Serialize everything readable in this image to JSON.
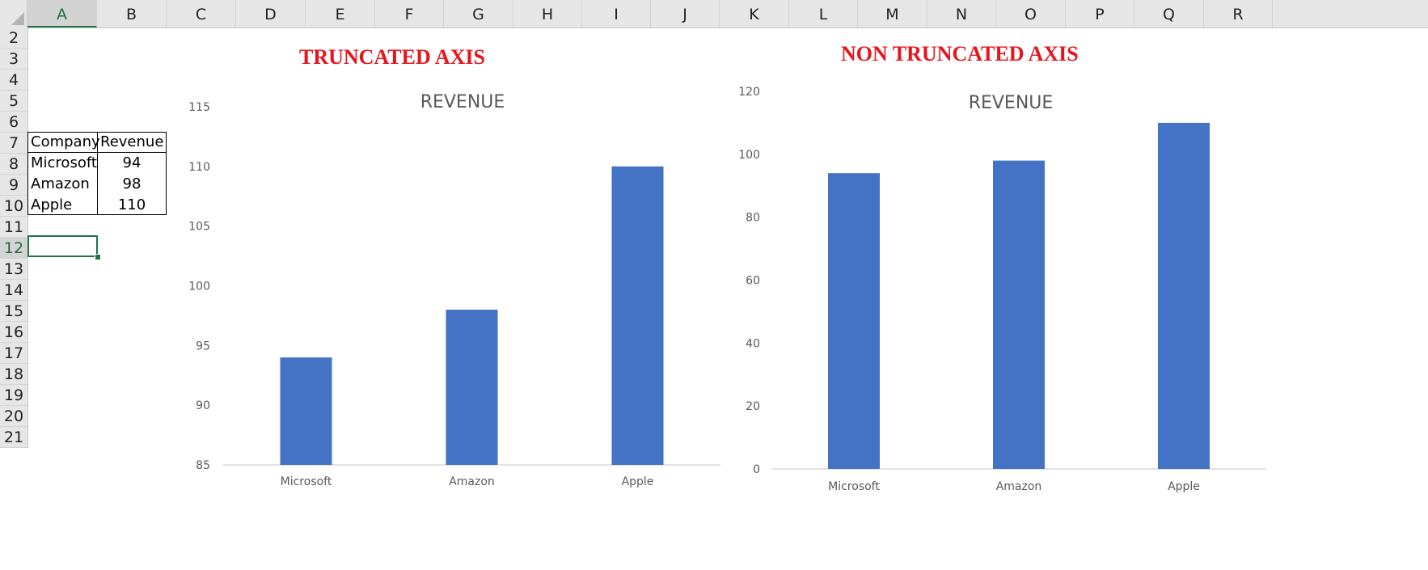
{
  "spreadsheet": {
    "columns": [
      "A",
      "B",
      "C",
      "D",
      "E",
      "F",
      "G",
      "H",
      "I",
      "J",
      "K",
      "L",
      "M",
      "N",
      "O",
      "P",
      "Q",
      "R"
    ],
    "rows": [
      "2",
      "3",
      "4",
      "5",
      "6",
      "7",
      "8",
      "9",
      "10",
      "11",
      "12",
      "13",
      "14",
      "15",
      "16",
      "17",
      "18",
      "19",
      "20",
      "21"
    ],
    "active_column": "A",
    "active_row": "12"
  },
  "table": {
    "headers": [
      "Company",
      "Revenue"
    ],
    "rows": [
      [
        "Microsoft",
        "94"
      ],
      [
        "Amazon",
        "98"
      ],
      [
        "Apple",
        "110"
      ]
    ]
  },
  "titles": {
    "left": "TRUNCATED AXIS",
    "right": "NON TRUNCATED AXIS"
  },
  "colors": {
    "bar": "#4472C4",
    "title_red": "#E8141C",
    "selection": "#217346"
  },
  "chart_data": [
    {
      "type": "bar",
      "title": "REVENUE",
      "categories": [
        "Microsoft",
        "Amazon",
        "Apple"
      ],
      "values": [
        94,
        98,
        110
      ],
      "ylim": [
        85,
        115
      ],
      "yticks": [
        85,
        90,
        95,
        100,
        105,
        110,
        115
      ],
      "xlabel": "",
      "ylabel": "",
      "grid": false
    },
    {
      "type": "bar",
      "title": "REVENUE",
      "categories": [
        "Microsoft",
        "Amazon",
        "Apple"
      ],
      "values": [
        94,
        98,
        110
      ],
      "ylim": [
        0,
        120
      ],
      "yticks": [
        0,
        20,
        40,
        60,
        80,
        100,
        120
      ],
      "xlabel": "",
      "ylabel": "",
      "grid": false
    }
  ]
}
